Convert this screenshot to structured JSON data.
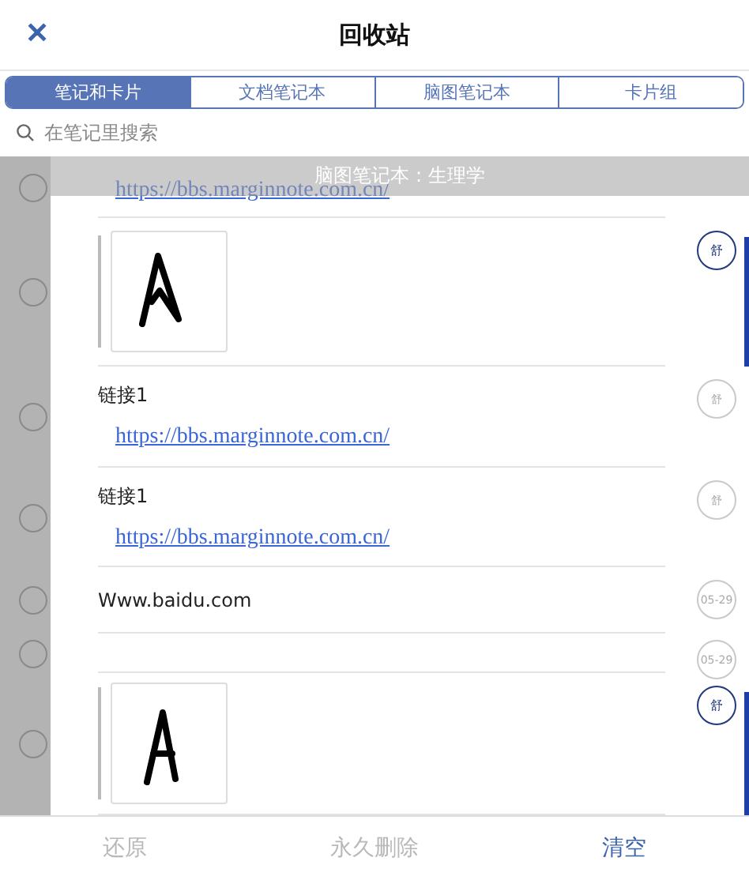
{
  "header": {
    "close": "✕",
    "title": "回收站"
  },
  "tabs": [
    {
      "label": "笔记和卡片",
      "selected": true
    },
    {
      "label": "文档笔记本",
      "selected": false
    },
    {
      "label": "脑图笔记本",
      "selected": false
    },
    {
      "label": "卡片组",
      "selected": false
    }
  ],
  "search": {
    "placeholder": "在笔记里搜索"
  },
  "section_banner": "脑图笔记本 : 生理学",
  "notes": [
    {
      "kind": "link",
      "link": "https://bbs.marginnote.com.cn/",
      "checked": false
    },
    {
      "badge": "舒",
      "highlighted": true,
      "checked": false
    },
    {
      "kind": "link",
      "title": "链接1",
      "link": "https://bbs.marginnote.com.cn/",
      "badge": "舒",
      "highlighted": false,
      "checked": false
    },
    {
      "kind": "link",
      "title": "链接1",
      "link": "https://bbs.marginnote.com.cn/",
      "badge": "舒",
      "highlighted": false,
      "checked": false
    },
    {
      "kind": "text",
      "title": "Www.baidu.com",
      "badge": "05-29",
      "highlighted": false,
      "checked": false
    },
    {
      "kind": "empty",
      "badge": "05-29",
      "highlighted": false,
      "checked": false
    },
    {
      "badge": "舒",
      "highlighted": true,
      "checked": false
    }
  ],
  "footer": [
    {
      "label": "还原",
      "disabled": true
    },
    {
      "label": "永久删除",
      "disabled": true
    },
    {
      "label": "清空",
      "disabled": false
    }
  ]
}
